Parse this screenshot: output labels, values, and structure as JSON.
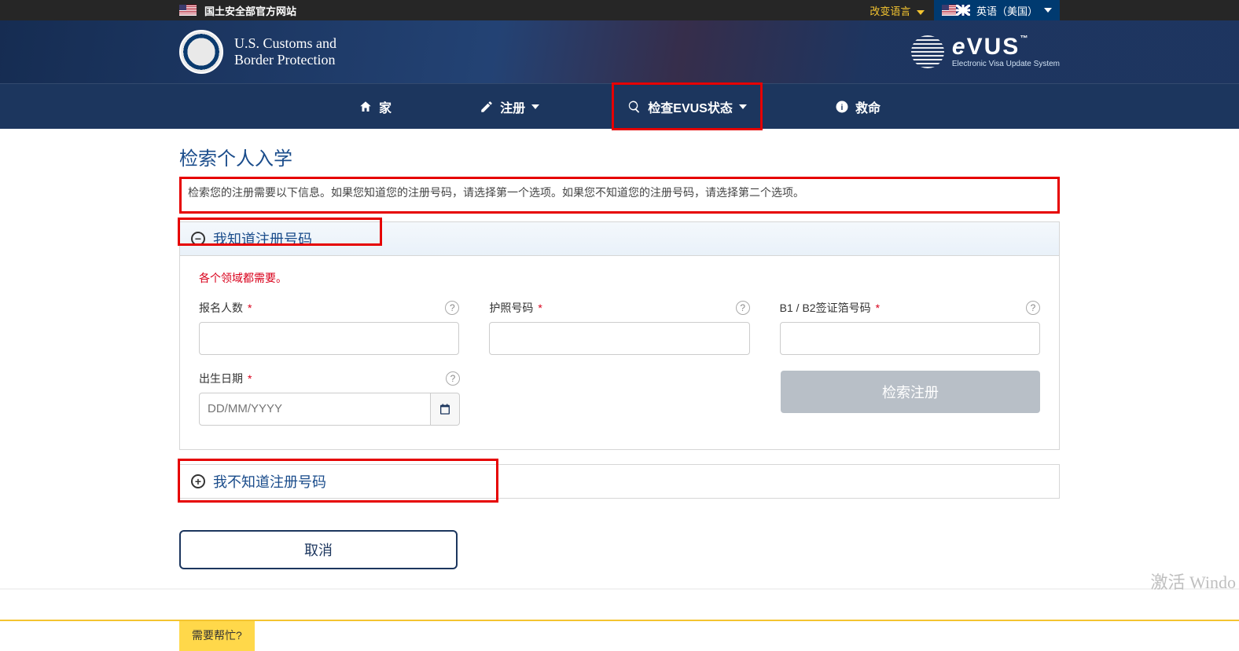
{
  "topbar": {
    "site_label": "国土安全部官方网站",
    "change_lang": "改变语言",
    "lang_selected": "英语（美国）"
  },
  "hero": {
    "cbp_line1": "U.S. Customs and",
    "cbp_line2": "Border Protection",
    "evus_brand": "eVUS",
    "evus_sub": "Electronic Visa Update System"
  },
  "nav": {
    "home": "家",
    "register": "注册",
    "check_status": "检查EVUS状态",
    "help": "救命"
  },
  "page": {
    "title": "检索个人入学",
    "intro": "检索您的注册需要以下信息。如果您知道您的注册号码，请选择第一个选项。如果您不知道您的注册号码，请选择第二个选项。"
  },
  "acc1": {
    "header": "我知道注册号码",
    "required_msg": "各个领域都需要。",
    "fields": {
      "enroll_label": "报名人数",
      "passport_label": "护照号码",
      "visa_label": "B1 / B2签证箔号码",
      "dob_label": "出生日期",
      "dob_placeholder": "DD/MM/YYYY"
    },
    "submit": "检索注册"
  },
  "acc2": {
    "header": "我不知道注册号码"
  },
  "actions": {
    "cancel": "取消"
  },
  "footer": {
    "need_help": "需要帮忙?",
    "activate": "激活 Windo"
  }
}
